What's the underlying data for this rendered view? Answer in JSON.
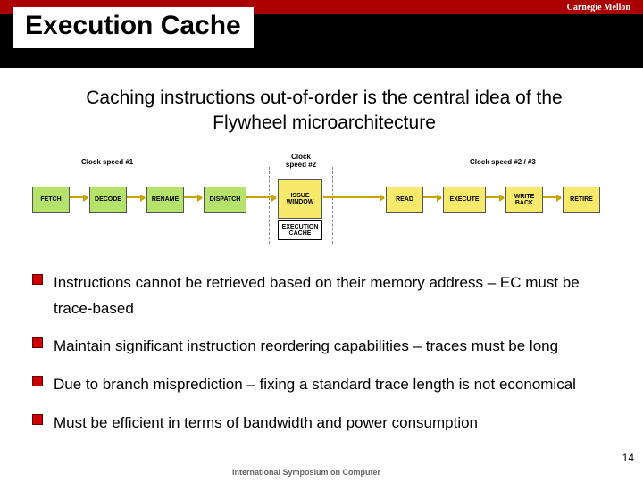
{
  "logo": {
    "brand": "Carnegie Mellon"
  },
  "title": "Execution Cache",
  "subtitle": "Caching instructions out-of-order is the central idea of the Flywheel microarchitecture",
  "diagram": {
    "speed1": "Clock speed #1",
    "speed2": "Clock speed #2",
    "speed3": "Clock speed #2 / #3",
    "stages": {
      "fetch": "FETCH",
      "decode": "DECODE",
      "rename": "RENAME",
      "dispatch": "DISPATCH",
      "issue": "ISSUE WINDOW",
      "ec": "EXECUTION CACHE",
      "read": "READ",
      "execute": "EXECUTE",
      "writeback": "WRITE BACK",
      "retire": "RETIRE"
    }
  },
  "bullets": [
    "Instructions cannot be retrieved based on their memory address – EC must be trace-based",
    "Maintain significant instruction reordering capabilities – traces must be long",
    "Due to branch misprediction – fixing a standard trace length is not economical",
    "Must be efficient in terms of bandwidth and power consumption"
  ],
  "footer": {
    "text": "International Symposium on Computer",
    "page": "14"
  }
}
